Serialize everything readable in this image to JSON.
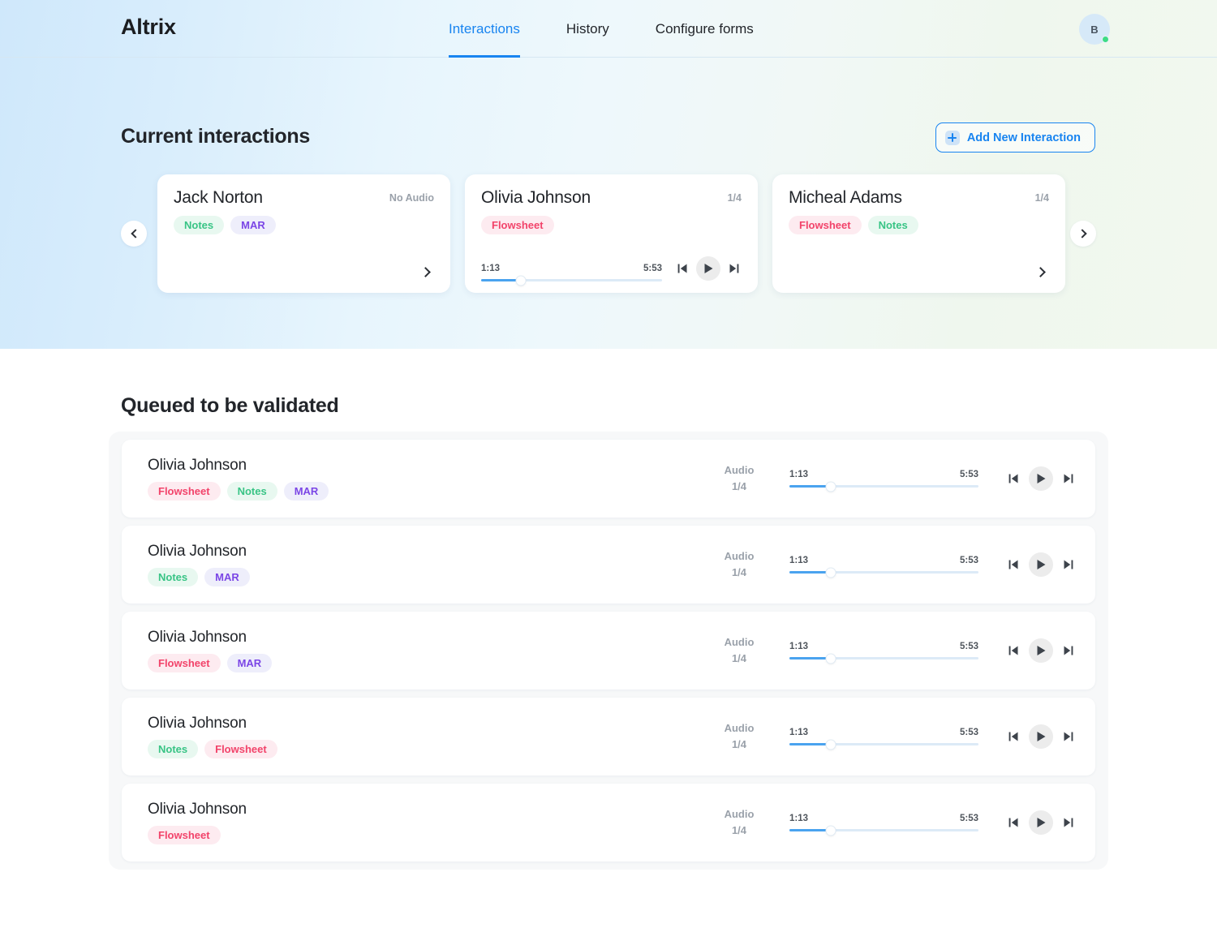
{
  "app": {
    "brand": "Altrix"
  },
  "nav": {
    "items": [
      {
        "label": "Interactions",
        "active": true
      },
      {
        "label": "History",
        "active": false
      },
      {
        "label": "Configure forms",
        "active": false
      }
    ],
    "avatar": {
      "initial": "B",
      "status": "online",
      "status_color": "#3ddc84"
    }
  },
  "colors": {
    "accent": "#1884f0",
    "tag_notes_text": "#38c485",
    "tag_notes_bg": "#e8f8f0",
    "tag_mar_text": "#7b46e6",
    "tag_mar_bg": "#eeeefb",
    "tag_flowsheet_text": "#f2436a",
    "tag_flowsheet_bg": "#fdebf0",
    "progress_fill": "#4aa3ef",
    "progress_track": "#dceaf7"
  },
  "current": {
    "title": "Current interactions",
    "add_button_label": "Add New Interaction",
    "add_button_icon": "plus-icon",
    "prev_icon": "chevron-left-icon",
    "next_icon": "chevron-right-icon",
    "cards": [
      {
        "name": "Jack Norton",
        "meta": "No Audio",
        "tags": [
          "Notes",
          "MAR"
        ],
        "has_player": false,
        "open_icon": "chevron-right-icon"
      },
      {
        "name": "Olivia Johnson",
        "meta": "1/4",
        "tags": [
          "Flowsheet"
        ],
        "has_player": true,
        "player": {
          "current_time": "1:13",
          "total_time": "5:53",
          "progress_percent": 22,
          "prev_icon": "skip-previous-icon",
          "play_icon": "play-icon",
          "next_icon": "skip-next-icon"
        }
      },
      {
        "name": "Micheal Adams",
        "meta": "1/4",
        "tags": [
          "Flowsheet",
          "Notes"
        ],
        "has_player": false,
        "open_icon": "chevron-right-icon"
      }
    ]
  },
  "queued": {
    "title": "Queued to be validated",
    "audio_label": "Audio",
    "rows": [
      {
        "name": "Olivia Johnson",
        "tags": [
          "Flowsheet",
          "Notes",
          "MAR"
        ],
        "audio_count": "1/4",
        "player": {
          "current_time": "1:13",
          "total_time": "5:53",
          "progress_percent": 22
        }
      },
      {
        "name": "Olivia Johnson",
        "tags": [
          "Notes",
          "MAR"
        ],
        "audio_count": "1/4",
        "player": {
          "current_time": "1:13",
          "total_time": "5:53",
          "progress_percent": 22
        }
      },
      {
        "name": "Olivia Johnson",
        "tags": [
          "Flowsheet",
          "MAR"
        ],
        "audio_count": "1/4",
        "player": {
          "current_time": "1:13",
          "total_time": "5:53",
          "progress_percent": 22
        }
      },
      {
        "name": "Olivia Johnson",
        "tags": [
          "Notes",
          "Flowsheet"
        ],
        "audio_count": "1/4",
        "player": {
          "current_time": "1:13",
          "total_time": "5:53",
          "progress_percent": 22
        }
      },
      {
        "name": "Olivia Johnson",
        "tags": [
          "Flowsheet"
        ],
        "audio_count": "1/4",
        "player": {
          "current_time": "1:13",
          "total_time": "5:53",
          "progress_percent": 22
        }
      }
    ]
  }
}
